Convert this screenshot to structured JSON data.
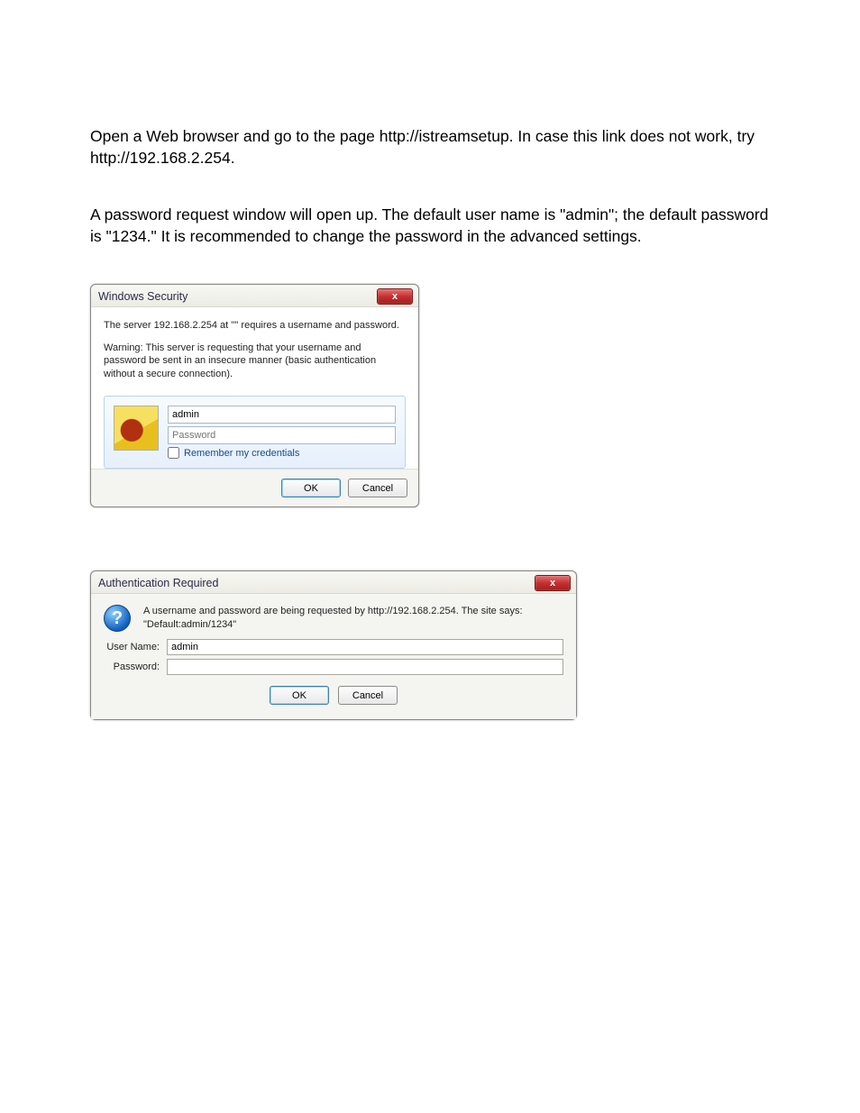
{
  "intro": {
    "p1": "Open a Web browser and go to the page http://istreamsetup. In case this link does not work, try http://192.168.2.254.",
    "p2": "A password request window will open up. The default user name is \"admin\"; the default password is \"1234.\" It is recommended to change the password in the advanced settings."
  },
  "dialog1": {
    "title": "Windows Security",
    "close": "x",
    "line1": "The server 192.168.2.254 at '\"' requires a username and password.",
    "warning": "Warning: This server is requesting that your username and password be sent in an insecure manner (basic authentication without a secure connection).",
    "username_value": "admin",
    "password_placeholder": "Password",
    "remember_label": "Remember my credentials",
    "ok": "OK",
    "cancel": "Cancel"
  },
  "dialog2": {
    "title": "Authentication Required",
    "close": "x",
    "question_glyph": "?",
    "message": "A username and password are being requested by http://192.168.2.254. The site says: \"Default:admin/1234\"",
    "username_label": "User Name:",
    "username_value": "admin",
    "password_label": "Password:",
    "password_value": "",
    "ok": "OK",
    "cancel": "Cancel"
  }
}
